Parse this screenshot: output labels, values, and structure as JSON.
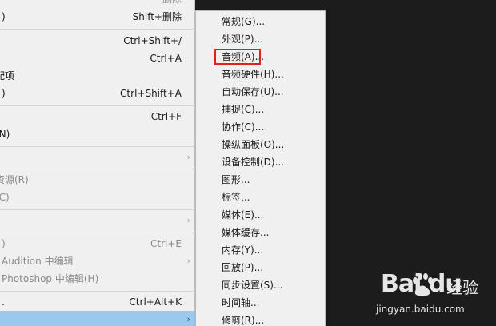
{
  "left_menu": {
    "items": [
      {
        "label": "",
        "shortcut": "删除"
      },
      {
        "label": ")",
        "shortcut": "Shift+删除"
      },
      {
        "label": "",
        "shortcut": "Ctrl+Shift+/"
      },
      {
        "label": "",
        "shortcut": "Ctrl+A"
      },
      {
        "label": "配项",
        "shortcut": ""
      },
      {
        "label": ")",
        "shortcut": "Ctrl+Shift+A"
      },
      {
        "label": "",
        "shortcut": "Ctrl+F"
      },
      {
        "label": "(N)",
        "shortcut": ""
      },
      {
        "label": "",
        "shortcut": "",
        "arrow": "›"
      },
      {
        "label": "资源(R)",
        "shortcut": ""
      },
      {
        "label": "(C)",
        "shortcut": ""
      },
      {
        "label": "",
        "shortcut": "",
        "arrow": "›"
      },
      {
        "label": ")",
        "shortcut": "Ctrl+E"
      },
      {
        "label": "Audition 中编辑",
        "shortcut": "",
        "arrow": "›"
      },
      {
        "label": "Photoshop 中编辑(H)",
        "shortcut": ""
      },
      {
        "label": ".",
        "shortcut": "Ctrl+Alt+K"
      },
      {
        "label": "",
        "shortcut": "",
        "arrow": "›"
      }
    ]
  },
  "submenu": {
    "items": [
      "常规(G)...",
      "外观(P)...",
      "音频(A)...",
      "音频硬件(H)...",
      "自动保存(U)...",
      "捕捉(C)...",
      "协作(C)...",
      "操纵面板(O)...",
      "设备控制(D)...",
      "图形...",
      "标签...",
      "媒体(E)...",
      "媒体缓存...",
      "内存(Y)...",
      "回放(P)...",
      "同步设置(S)...",
      "时间轴...",
      "修剪(R)..."
    ]
  },
  "watermark": {
    "logo": "Bai du",
    "cn": "经验",
    "url": "jingyan.baidu.com"
  },
  "colors": {
    "menu_bg": "#f0f0f0",
    "highlight": "#99c9ef",
    "annotation": "#e02020",
    "backdrop": "#1c1c1c"
  }
}
